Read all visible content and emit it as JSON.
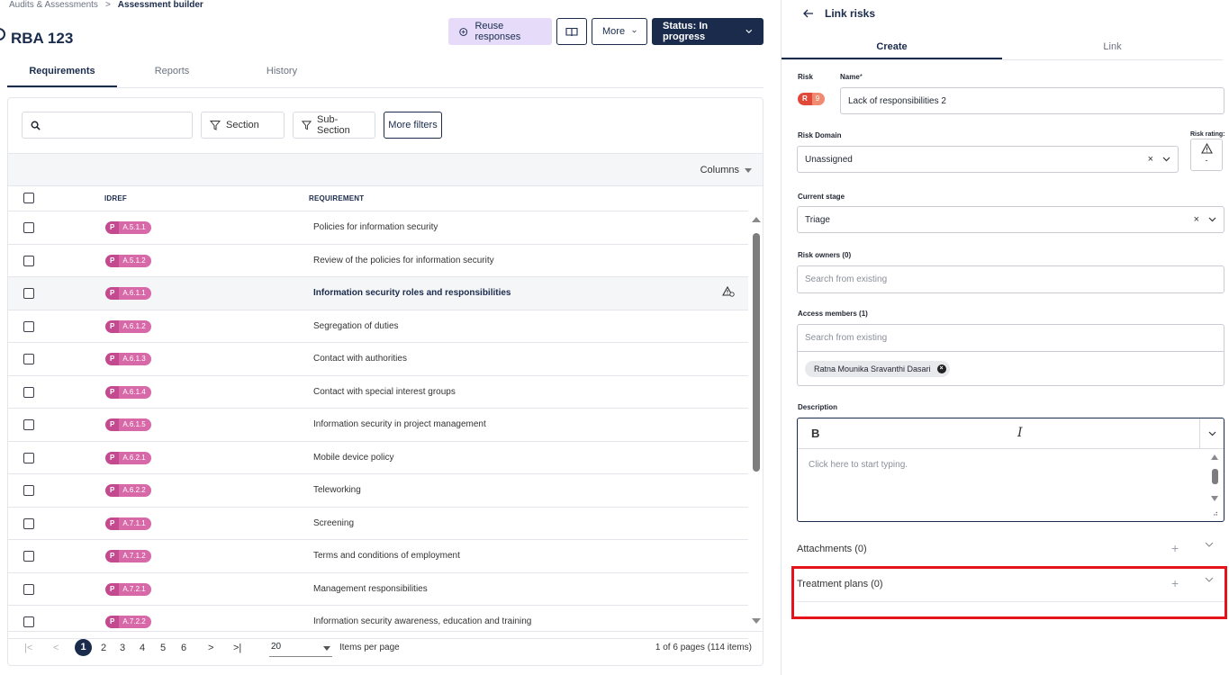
{
  "breadcrumb": {
    "parent": "Audits & Assessments",
    "separator": ">",
    "current": "Assessment builder"
  },
  "page": {
    "title": "RBA 123"
  },
  "header_actions": {
    "reuse_label": "Reuse responses",
    "more_label": "More",
    "status_label": "Status: In progress"
  },
  "tabs": [
    {
      "label": "Requirements"
    },
    {
      "label": "Reports"
    },
    {
      "label": "History"
    }
  ],
  "filters": {
    "search_placeholder": "",
    "section_label": "Section",
    "subsection_label": "Sub-Section",
    "more_filters_label": "More filters"
  },
  "columns_label": "Columns",
  "table": {
    "headers": {
      "idref": "IDREF",
      "requirement": "REQUIREMENT"
    },
    "rows": [
      {
        "prefix": "P",
        "id": "A.5.1.1",
        "requirement": "Policies for information security"
      },
      {
        "prefix": "P",
        "id": "A.5.1.2",
        "requirement": "Review of the policies for information security"
      },
      {
        "prefix": "P",
        "id": "A.6.1.1",
        "requirement": "Information security roles and responsibilities"
      },
      {
        "prefix": "P",
        "id": "A.6.1.2",
        "requirement": "Segregation of duties"
      },
      {
        "prefix": "P",
        "id": "A.6.1.3",
        "requirement": "Contact with authorities"
      },
      {
        "prefix": "P",
        "id": "A.6.1.4",
        "requirement": "Contact with special interest groups"
      },
      {
        "prefix": "P",
        "id": "A.6.1.5",
        "requirement": "Information security in project management"
      },
      {
        "prefix": "P",
        "id": "A.6.2.1",
        "requirement": "Mobile device policy"
      },
      {
        "prefix": "P",
        "id": "A.6.2.2",
        "requirement": "Teleworking"
      },
      {
        "prefix": "P",
        "id": "A.7.1.1",
        "requirement": "Screening"
      },
      {
        "prefix": "P",
        "id": "A.7.1.2",
        "requirement": "Terms and conditions of employment"
      },
      {
        "prefix": "P",
        "id": "A.7.2.1",
        "requirement": "Management responsibilities"
      },
      {
        "prefix": "P",
        "id": "A.7.2.2",
        "requirement": "Information security awareness, education and training"
      }
    ]
  },
  "pagination": {
    "first": "|<",
    "prev": "<",
    "pages": [
      "1",
      "2",
      "3",
      "4",
      "5",
      "6"
    ],
    "current": "1",
    "next": ">",
    "last": ">|",
    "per_page_value": "20",
    "per_page_label": "Items per page",
    "info": "1 of 6 pages (114 items)"
  },
  "panel": {
    "title": "Link risks",
    "tabs": [
      {
        "label": "Create"
      },
      {
        "label": "Link"
      }
    ],
    "risk_label": "Risk",
    "risk_badge": {
      "prefix": "R",
      "value": "9"
    },
    "name_label": "Name",
    "name_required": "*",
    "name_value": "Lack of responsibilities 2",
    "risk_domain_label": "Risk Domain",
    "risk_domain_value": "Unassigned",
    "risk_rating_label": "Risk rating:",
    "risk_rating_value": "-",
    "current_stage_label": "Current stage",
    "current_stage_value": "Triage",
    "risk_owners_label": "Risk owners (0)",
    "risk_owners_placeholder": "Search from existing",
    "access_members_label": "Access members (1)",
    "access_members_placeholder": "Search from existing",
    "access_member_chip": "Ratna Mounika Sravanthi Dasari",
    "description_label": "Description",
    "editor_bold": "B",
    "editor_italic": "I",
    "editor_placeholder": "Click here to start typing.",
    "attachments_label": "Attachments (0)",
    "treatment_plans_label": "Treatment plans (0)"
  },
  "colors": {
    "navy": "#1a2b4c",
    "lavender": "#e6dcfa",
    "pill_pink": "#c44a8f",
    "risk_red": "#e0493a",
    "highlight_red": "#e5141b"
  }
}
